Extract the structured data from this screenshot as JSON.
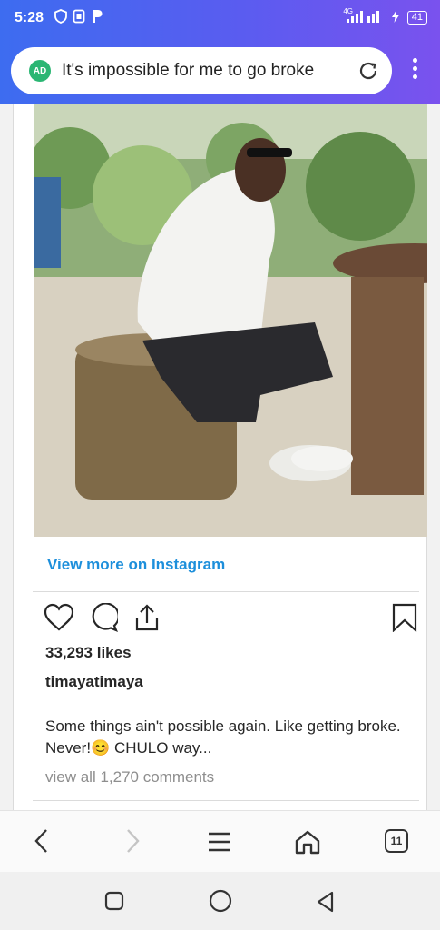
{
  "status_bar": {
    "time": "5:28",
    "network": "4G",
    "battery": "41"
  },
  "browser": {
    "ad_badge": "AD",
    "url_text": "It's impossible for me to go broke",
    "tab_count": "11"
  },
  "post": {
    "view_more": "View more on Instagram",
    "likes": "33,293 likes",
    "username": "timayatimaya",
    "caption": "Some things ain't possible again. Like getting broke. Never!😊 CHULO way...",
    "comments": "view all 1,270 comments"
  },
  "colors": {
    "accent": "#1d8fdb",
    "ad_green": "#2bb673",
    "gradient_start": "#3d6cf0",
    "gradient_end": "#7a52ee"
  },
  "icons": [
    "shield-icon",
    "sim-icon",
    "p-icon",
    "signal-icon",
    "charging-icon",
    "reload-icon",
    "more-vert-icon",
    "heart-icon",
    "comment-icon",
    "share-icon",
    "bookmark-icon",
    "back-icon",
    "forward-icon",
    "menu-icon",
    "home-icon",
    "tabs-icon",
    "recents-icon",
    "home-circle-icon",
    "back-triangle-icon"
  ]
}
